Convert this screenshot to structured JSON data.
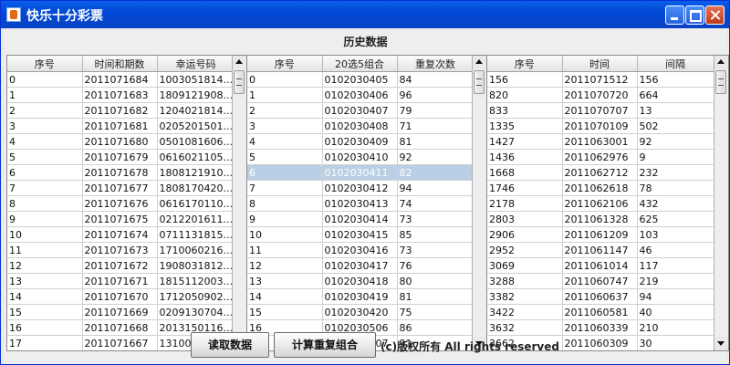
{
  "window": {
    "title": "快乐十分彩票"
  },
  "heading": "历史数据",
  "table1": {
    "headers": [
      "序号",
      "时间和期数",
      "幸运号码"
    ],
    "rows": [
      [
        "0",
        "2011071684",
        "1003051814..."
      ],
      [
        "1",
        "2011071683",
        "1809121908..."
      ],
      [
        "2",
        "2011071682",
        "1204021814..."
      ],
      [
        "3",
        "2011071681",
        "0205201501..."
      ],
      [
        "4",
        "2011071680",
        "0501081606..."
      ],
      [
        "5",
        "2011071679",
        "0616021105..."
      ],
      [
        "6",
        "2011071678",
        "1808121910..."
      ],
      [
        "7",
        "2011071677",
        "1808170420..."
      ],
      [
        "8",
        "2011071676",
        "0616170110..."
      ],
      [
        "9",
        "2011071675",
        "0212201611..."
      ],
      [
        "10",
        "2011071674",
        "0711131815..."
      ],
      [
        "11",
        "2011071673",
        "1710060216..."
      ],
      [
        "12",
        "2011071672",
        "1908031812..."
      ],
      [
        "13",
        "2011071671",
        "1815112003..."
      ],
      [
        "14",
        "2011071670",
        "1712050902..."
      ],
      [
        "15",
        "2011071669",
        "0209130704..."
      ],
      [
        "16",
        "2011071668",
        "2013150116..."
      ],
      [
        "17",
        "2011071667",
        "1310061911..."
      ]
    ]
  },
  "table2": {
    "headers": [
      "序号",
      "20选5组合",
      "重复次数"
    ],
    "selected_row": 6,
    "rows": [
      [
        "0",
        "0102030405",
        "84"
      ],
      [
        "1",
        "0102030406",
        "96"
      ],
      [
        "2",
        "0102030407",
        "79"
      ],
      [
        "3",
        "0102030408",
        "71"
      ],
      [
        "4",
        "0102030409",
        "81"
      ],
      [
        "5",
        "0102030410",
        "92"
      ],
      [
        "6",
        "0102030411",
        "82"
      ],
      [
        "7",
        "0102030412",
        "94"
      ],
      [
        "8",
        "0102030413",
        "74"
      ],
      [
        "9",
        "0102030414",
        "73"
      ],
      [
        "10",
        "0102030415",
        "85"
      ],
      [
        "11",
        "0102030416",
        "73"
      ],
      [
        "12",
        "0102030417",
        "76"
      ],
      [
        "13",
        "0102030418",
        "80"
      ],
      [
        "14",
        "0102030419",
        "81"
      ],
      [
        "15",
        "0102030420",
        "75"
      ],
      [
        "16",
        "0102030506",
        "86"
      ],
      [
        "17",
        "0102030507",
        "91"
      ]
    ]
  },
  "table3": {
    "headers": [
      "序号",
      "时间",
      "间隔"
    ],
    "rows": [
      [
        "156",
        "2011071512",
        "156"
      ],
      [
        "820",
        "2011070720",
        "664"
      ],
      [
        "833",
        "2011070707",
        "13"
      ],
      [
        "1335",
        "2011070109",
        "502"
      ],
      [
        "1427",
        "2011063001",
        "92"
      ],
      [
        "1436",
        "2011062976",
        "9"
      ],
      [
        "1668",
        "2011062712",
        "232"
      ],
      [
        "1746",
        "2011062618",
        "78"
      ],
      [
        "2178",
        "2011062106",
        "432"
      ],
      [
        "2803",
        "2011061328",
        "625"
      ],
      [
        "2906",
        "2011061209",
        "103"
      ],
      [
        "2952",
        "2011061147",
        "46"
      ],
      [
        "3069",
        "2011061014",
        "117"
      ],
      [
        "3288",
        "2011060747",
        "219"
      ],
      [
        "3382",
        "2011060637",
        "94"
      ],
      [
        "3422",
        "2011060581",
        "40"
      ],
      [
        "3632",
        "2011060339",
        "210"
      ],
      [
        "3662",
        "2011060309",
        "30"
      ]
    ]
  },
  "buttons": {
    "read": "读取数据",
    "calc": "计算重复组合"
  },
  "copyright": "(c)版权所有  All rights reserved"
}
